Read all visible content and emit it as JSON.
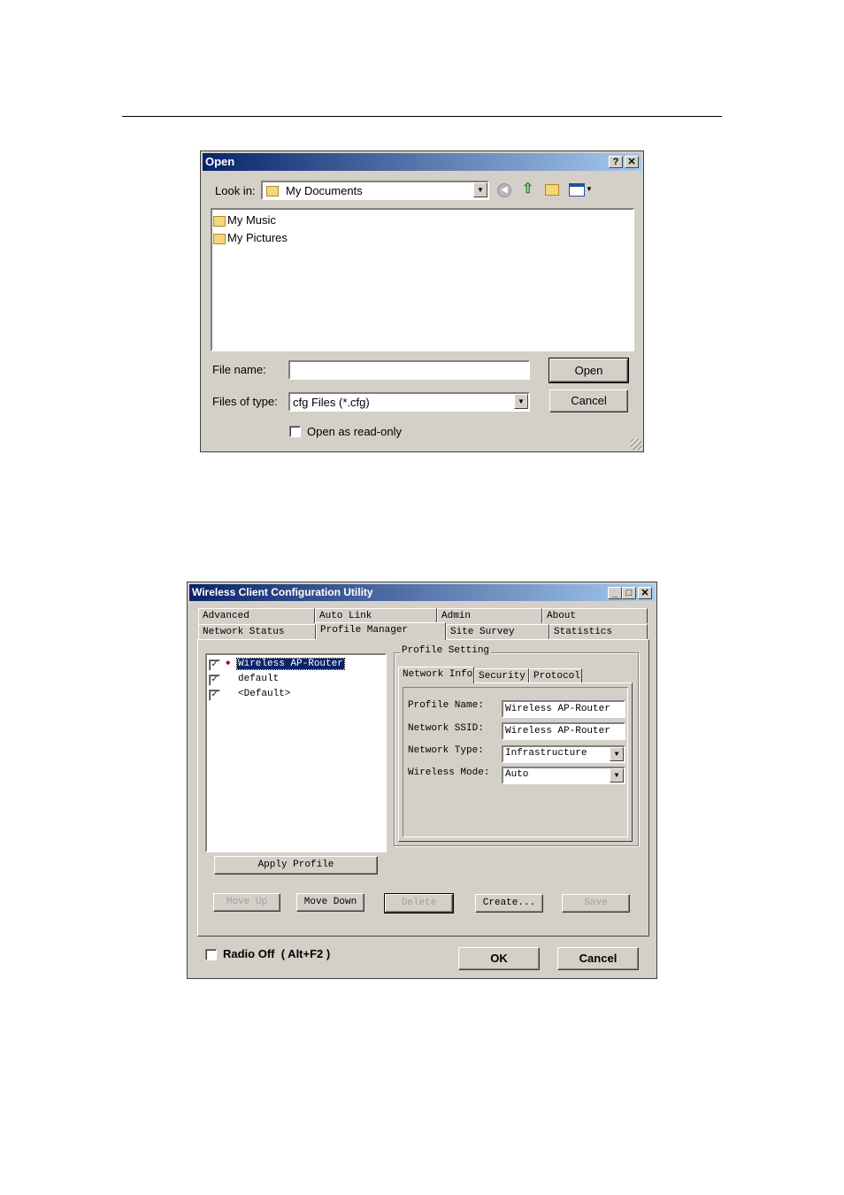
{
  "open_dialog": {
    "title": "Open",
    "help_btn": "?",
    "close_btn": "✕",
    "look_in_label": "Look in:",
    "look_in_value": "My Documents",
    "files": [
      "My Music",
      "My Pictures"
    ],
    "file_name_label": "File name:",
    "file_name_value": "",
    "files_of_type_label": "Files of type:",
    "files_of_type_value": "cfg Files (*.cfg)",
    "open_button": "Open",
    "cancel_button": "Cancel",
    "read_only_label": "Open as read-only"
  },
  "wcu": {
    "title": "Wireless Client Configuration Utility",
    "tabs_row1": [
      "Advanced",
      "Auto Link",
      "Admin",
      "About"
    ],
    "tabs_row2": [
      "Network Status",
      "Profile Manager",
      "Site Survey",
      "Statistics"
    ],
    "active_tab": "Profile Manager",
    "profiles": [
      {
        "name": "Wireless AP-Router",
        "checked": "✓",
        "active": true
      },
      {
        "name": "default",
        "checked": "✓",
        "active": false
      },
      {
        "name": "<Default>",
        "checked": "✓",
        "active": false
      }
    ],
    "apply_profile": "Apply Profile",
    "profile_setting_label": "Profile Setting",
    "sub_tabs": [
      "Network Info",
      "Security",
      "Protocol"
    ],
    "profile_name_label": "Profile Name:",
    "profile_name_value": "Wireless AP-Router",
    "network_ssid_label": "Network SSID:",
    "network_ssid_value": "Wireless AP-Router",
    "network_type_label": "Network Type:",
    "network_type_value": "Infrastructure",
    "wireless_mode_label": "Wireless Mode:",
    "wireless_mode_value": "Auto",
    "move_up": "Move Up",
    "move_down": "Move Down",
    "delete": "Delete",
    "create": "Create...",
    "save": "Save",
    "radio_off": "Radio Off  ( Alt+F2 )",
    "ok": "OK",
    "cancel": "Cancel"
  }
}
